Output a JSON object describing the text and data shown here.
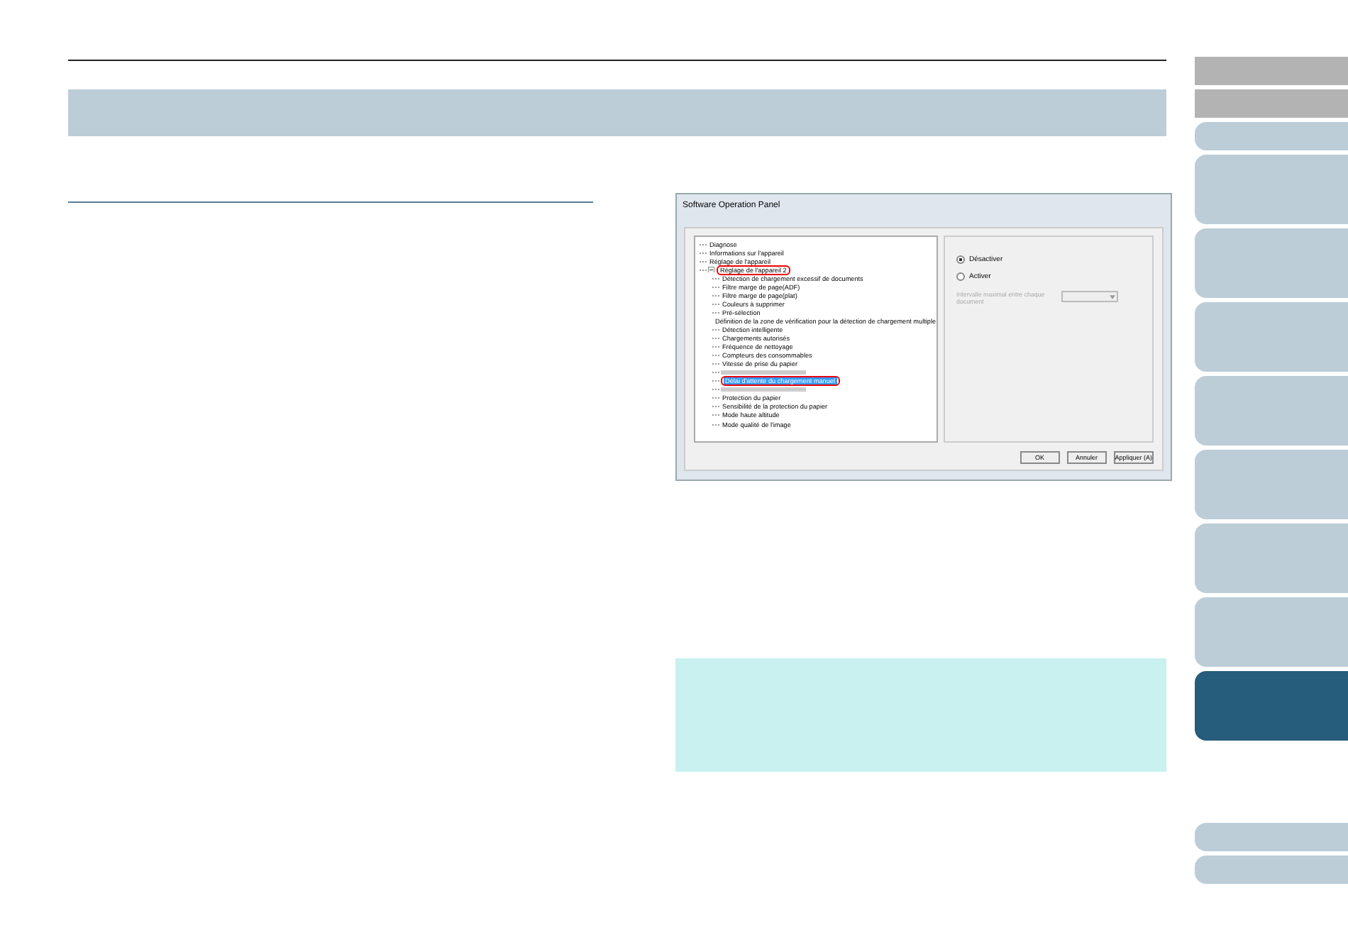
{
  "side_tabs": [
    {
      "kind": "gray"
    },
    {
      "kind": "gray"
    },
    {
      "kind": "small"
    },
    {
      "kind": "large"
    },
    {
      "kind": "large"
    },
    {
      "kind": "large"
    },
    {
      "kind": "large"
    },
    {
      "kind": "large"
    },
    {
      "kind": "large"
    },
    {
      "kind": "large"
    },
    {
      "kind": "current"
    },
    {
      "kind": "gap"
    },
    {
      "kind": "small"
    },
    {
      "kind": "small"
    }
  ],
  "dialog": {
    "title": "Software Operation Panel",
    "tree": [
      {
        "label": "Diagnose",
        "selected": false,
        "circled": false
      },
      {
        "label": "Informations sur l'appareil",
        "selected": false,
        "circled": false
      },
      {
        "label": "Réglage de l'appareil",
        "selected": false,
        "circled": false
      },
      {
        "label": "Réglage de l'appareil 2",
        "selected": false,
        "circled": true,
        "expanded": true,
        "children": [
          {
            "label": "Détection de chargement excessif de documents",
            "selected": false,
            "circled": false
          },
          {
            "label": "Filtre marge de page(ADF)",
            "selected": false,
            "circled": false
          },
          {
            "label": "Filtre marge de page(plat)",
            "selected": false,
            "circled": false
          },
          {
            "label": "Couleurs à supprimer",
            "selected": false,
            "circled": false
          },
          {
            "label": "Pré-sélection",
            "selected": false,
            "circled": false
          },
          {
            "label": "Définition de la zone de vérification pour la détection de chargement multiple",
            "selected": false,
            "circled": false
          },
          {
            "label": "Détection intelligente",
            "selected": false,
            "circled": false
          },
          {
            "label": "Chargements autorisés",
            "selected": false,
            "circled": false
          },
          {
            "label": "Fréquence de nettoyage",
            "selected": false,
            "circled": false
          },
          {
            "label": "Compteurs des consommables",
            "selected": false,
            "circled": false
          },
          {
            "label": "Vitesse de prise du papier",
            "selected": false,
            "circled": false
          },
          {
            "obscured": true
          },
          {
            "label": "Délai d'attente du chargement manuel",
            "selected": true,
            "circled": true
          },
          {
            "obscured": true
          },
          {
            "label": "Protection du papier",
            "selected": false,
            "circled": false
          },
          {
            "label": "Sensibilité de la protection du papier",
            "selected": false,
            "circled": false
          },
          {
            "label": "Mode haute altitude",
            "selected": false,
            "circled": false
          },
          {
            "label": "Mode qualité de l'image",
            "selected": false,
            "circled": false
          }
        ]
      }
    ],
    "options": [
      {
        "label": "Désactiver",
        "selected": true
      },
      {
        "label": "Activer",
        "selected": false
      }
    ],
    "interval": {
      "label": "Intervalle maximal entre chaque document",
      "disabled": true
    },
    "buttons": [
      "OK",
      "Annuler",
      "Appliquer (A)"
    ]
  }
}
